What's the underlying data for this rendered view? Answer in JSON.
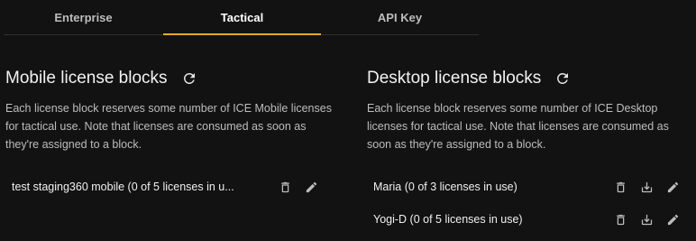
{
  "tabs": [
    {
      "label": "Enterprise",
      "active": false
    },
    {
      "label": "Tactical",
      "active": true
    },
    {
      "label": "API Key",
      "active": false
    }
  ],
  "accent_color": "#f5a623",
  "mobile": {
    "title": "Mobile license blocks",
    "description": "Each license block reserves some number of ICE Mobile licenses for tactical use. Note that licenses are consumed as soon as they're assigned to a block.",
    "items": [
      {
        "label": "test staging360 mobile  (0 of 5 licenses in u...",
        "icons": [
          "delete-icon",
          "edit-icon"
        ]
      }
    ]
  },
  "desktop": {
    "title": "Desktop license blocks",
    "description": "Each license block reserves some number of ICE Desktop licenses for tactical use. Note that licenses are consumed as soon as they're assigned to a block.",
    "items": [
      {
        "label": "Maria (0 of 3 licenses in use)",
        "icons": [
          "delete-icon",
          "download-icon",
          "edit-icon"
        ]
      },
      {
        "label": "Yogi-D (0 of 5 licenses in use)",
        "icons": [
          "delete-icon",
          "download-icon",
          "edit-icon"
        ]
      }
    ]
  }
}
